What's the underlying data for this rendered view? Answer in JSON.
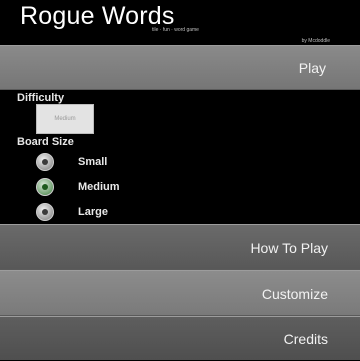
{
  "header": {
    "title": "Rogue Words",
    "subtitle": "tile · fun · word game",
    "small_credit": "by Mcdoddle"
  },
  "menu": {
    "play_label": "Play",
    "how_to_play_label": "How To Play",
    "customize_label": "Customize",
    "credits_label": "Credits"
  },
  "settings": {
    "difficulty_label": "Difficulty",
    "difficulty_value": "Medium",
    "board_size_label": "Board Size",
    "board_sizes": [
      {
        "label": "Small",
        "selected": false
      },
      {
        "label": "Medium",
        "selected": true
      },
      {
        "label": "Large",
        "selected": false
      }
    ]
  }
}
